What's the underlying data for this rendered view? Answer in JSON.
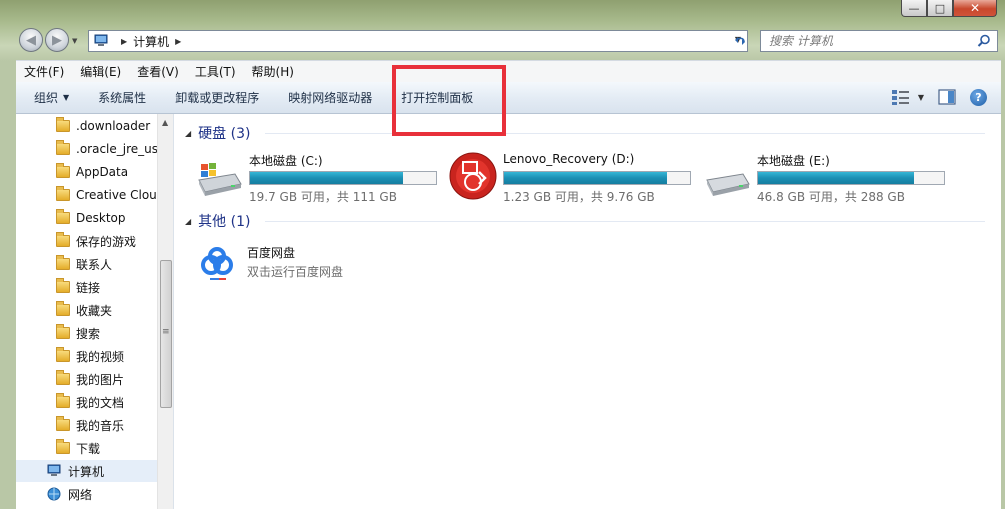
{
  "window": {
    "min_glyph": "—",
    "max_glyph": "□",
    "close_glyph": "✕"
  },
  "nav": {
    "back_glyph": "◀",
    "forward_glyph": "▶",
    "breadcrumb_sep": "▶",
    "address_location": "计算机",
    "search_placeholder": "搜索 计算机"
  },
  "menu": [
    "文件(F)",
    "编辑(E)",
    "查看(V)",
    "工具(T)",
    "帮助(H)"
  ],
  "commands": [
    {
      "label": "组织",
      "has_caret": true
    },
    {
      "label": "系统属性"
    },
    {
      "label": "卸载或更改程序"
    },
    {
      "label": "映射网络驱动器"
    },
    {
      "label": "打开控制面板"
    }
  ],
  "help_glyph": "?",
  "highlight_color": "#e8303a",
  "sidebar": {
    "items": [
      {
        "label": ".downloader",
        "icon": "folder-icon"
      },
      {
        "label": ".oracle_jre_usage",
        "icon": "folder-icon"
      },
      {
        "label": "AppData",
        "icon": "folder-icon"
      },
      {
        "label": "Creative Cloud Files",
        "icon": "folder-icon"
      },
      {
        "label": "Desktop",
        "icon": "folder-icon"
      },
      {
        "label": "保存的游戏",
        "icon": "saved-games-icon"
      },
      {
        "label": "联系人",
        "icon": "contacts-icon"
      },
      {
        "label": "链接",
        "icon": "links-icon"
      },
      {
        "label": "收藏夹",
        "icon": "favorites-icon"
      },
      {
        "label": "搜索",
        "icon": "searches-icon"
      },
      {
        "label": "我的视频",
        "icon": "videos-icon"
      },
      {
        "label": "我的图片",
        "icon": "pictures-icon"
      },
      {
        "label": "我的文档",
        "icon": "documents-icon"
      },
      {
        "label": "我的音乐",
        "icon": "music-icon"
      },
      {
        "label": "下载",
        "icon": "downloads-icon"
      },
      {
        "label": "计算机",
        "icon": "computer-icon",
        "selected": true
      },
      {
        "label": "网络",
        "icon": "network-icon"
      }
    ]
  },
  "groups": {
    "hdd": {
      "title": "硬盘 (3)"
    },
    "other": {
      "title": "其他 (1)"
    }
  },
  "drives": [
    {
      "name": "本地磁盘 (C:)",
      "free": "19.7 GB 可用，共 111 GB",
      "used_fraction": 0.823,
      "icon": "windows-drive-icon"
    },
    {
      "name": "Lenovo_Recovery (D:)",
      "free": "1.23 GB 可用，共 9.76 GB",
      "used_fraction": 0.874,
      "icon": "lenovo-recovery-icon"
    },
    {
      "name": "本地磁盘 (E:)",
      "free": "46.8 GB 可用，共 288 GB",
      "used_fraction": 0.838,
      "icon": "hard-drive-icon"
    }
  ],
  "apps": [
    {
      "name": "百度网盘",
      "desc": "双击运行百度网盘",
      "icon": "baidu-netdisk-icon"
    }
  ]
}
